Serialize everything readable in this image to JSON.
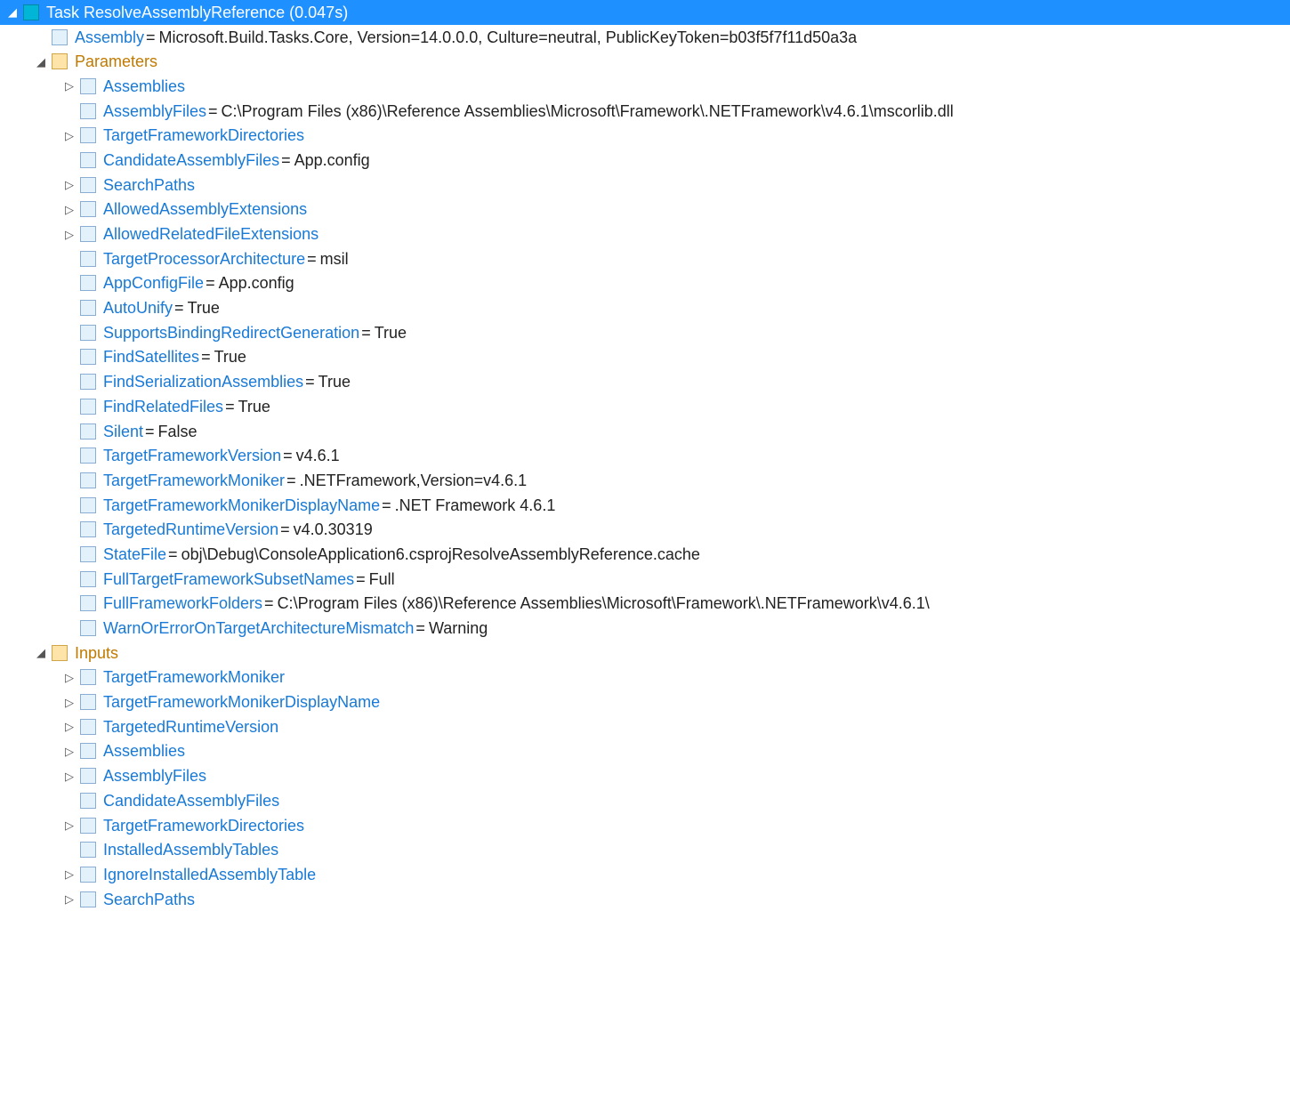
{
  "task": {
    "prefix": "Task",
    "name": "ResolveAssemblyReference",
    "duration": "(0.047s)"
  },
  "assembly": {
    "key": "Assembly",
    "value": "Microsoft.Build.Tasks.Core, Version=14.0.0.0, Culture=neutral, PublicKeyToken=b03f5f7f11d50a3a"
  },
  "parametersLabel": "Parameters",
  "parameters": [
    {
      "expander": "closed",
      "key": "Assemblies"
    },
    {
      "expander": "none",
      "key": "AssemblyFiles",
      "value": "C:\\Program Files (x86)\\Reference Assemblies\\Microsoft\\Framework\\.NETFramework\\v4.6.1\\mscorlib.dll"
    },
    {
      "expander": "closed",
      "key": "TargetFrameworkDirectories"
    },
    {
      "expander": "none",
      "key": "CandidateAssemblyFiles",
      "value": "App.config"
    },
    {
      "expander": "closed",
      "key": "SearchPaths"
    },
    {
      "expander": "closed",
      "key": "AllowedAssemblyExtensions"
    },
    {
      "expander": "closed",
      "key": "AllowedRelatedFileExtensions"
    },
    {
      "expander": "none",
      "key": "TargetProcessorArchitecture",
      "value": "msil"
    },
    {
      "expander": "none",
      "key": "AppConfigFile",
      "value": "App.config"
    },
    {
      "expander": "none",
      "key": "AutoUnify",
      "value": "True"
    },
    {
      "expander": "none",
      "key": "SupportsBindingRedirectGeneration",
      "value": "True"
    },
    {
      "expander": "none",
      "key": "FindSatellites",
      "value": "True"
    },
    {
      "expander": "none",
      "key": "FindSerializationAssemblies",
      "value": "True"
    },
    {
      "expander": "none",
      "key": "FindRelatedFiles",
      "value": "True"
    },
    {
      "expander": "none",
      "key": "Silent",
      "value": "False"
    },
    {
      "expander": "none",
      "key": "TargetFrameworkVersion",
      "value": "v4.6.1"
    },
    {
      "expander": "none",
      "key": "TargetFrameworkMoniker",
      "value": ".NETFramework,Version=v4.6.1"
    },
    {
      "expander": "none",
      "key": "TargetFrameworkMonikerDisplayName",
      "value": ".NET Framework 4.6.1"
    },
    {
      "expander": "none",
      "key": "TargetedRuntimeVersion",
      "value": "v4.0.30319"
    },
    {
      "expander": "none",
      "key": "StateFile",
      "value": "obj\\Debug\\ConsoleApplication6.csprojResolveAssemblyReference.cache"
    },
    {
      "expander": "none",
      "key": "FullTargetFrameworkSubsetNames",
      "value": "Full"
    },
    {
      "expander": "none",
      "key": "FullFrameworkFolders",
      "value": "C:\\Program Files (x86)\\Reference Assemblies\\Microsoft\\Framework\\.NETFramework\\v4.6.1\\"
    },
    {
      "expander": "none",
      "key": "WarnOrErrorOnTargetArchitectureMismatch",
      "value": "Warning"
    }
  ],
  "inputsLabel": "Inputs",
  "inputs": [
    {
      "expander": "closed",
      "key": "TargetFrameworkMoniker"
    },
    {
      "expander": "closed",
      "key": "TargetFrameworkMonikerDisplayName"
    },
    {
      "expander": "closed",
      "key": "TargetedRuntimeVersion"
    },
    {
      "expander": "closed",
      "key": "Assemblies"
    },
    {
      "expander": "closed",
      "key": "AssemblyFiles"
    },
    {
      "expander": "none",
      "key": "CandidateAssemblyFiles"
    },
    {
      "expander": "closed",
      "key": "TargetFrameworkDirectories"
    },
    {
      "expander": "none",
      "key": "InstalledAssemblyTables"
    },
    {
      "expander": "closed",
      "key": "IgnoreInstalledAssemblyTable"
    },
    {
      "expander": "closed",
      "key": "SearchPaths"
    }
  ]
}
